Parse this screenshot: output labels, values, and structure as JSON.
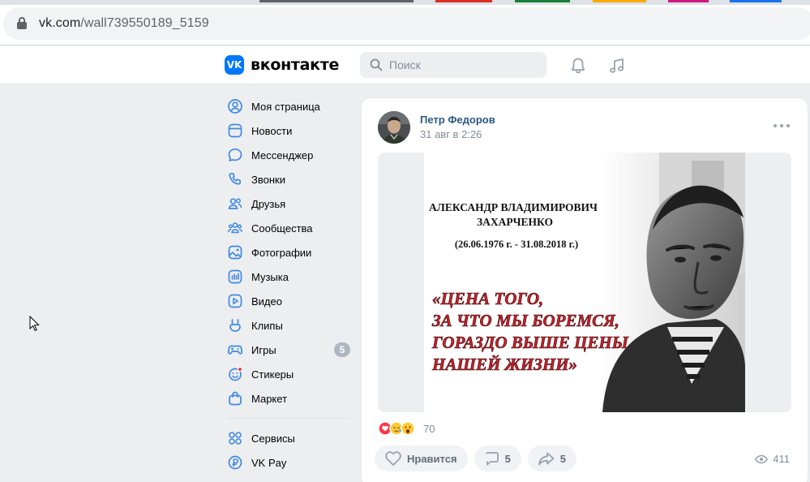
{
  "browser": {
    "url_host": "vk.com",
    "url_path": "/wall739550189_5159",
    "tab_colors": [
      "#2f6fd6",
      "#d93025",
      "#188038",
      "#f9ab00",
      "#d01884",
      "#1a73e8"
    ]
  },
  "header": {
    "logo_mark": "VK",
    "logo_text": "вконтакте",
    "search_placeholder": "Поиск",
    "notifications_icon": "bell-icon",
    "music_icon": "music-note-icon"
  },
  "nav": {
    "items": [
      {
        "label": "Моя страница",
        "icon": "user-circle-icon"
      },
      {
        "label": "Новости",
        "icon": "newsfeed-icon"
      },
      {
        "label": "Мессенджер",
        "icon": "message-bubble-icon"
      },
      {
        "label": "Звонки",
        "icon": "phone-icon"
      },
      {
        "label": "Друзья",
        "icon": "friends-icon"
      },
      {
        "label": "Сообщества",
        "icon": "communities-icon"
      },
      {
        "label": "Фотографии",
        "icon": "photo-icon"
      },
      {
        "label": "Музыка",
        "icon": "music-icon"
      },
      {
        "label": "Видео",
        "icon": "video-icon"
      },
      {
        "label": "Клипы",
        "icon": "clips-icon"
      },
      {
        "label": "Игры",
        "icon": "gamepad-icon",
        "badge": "5"
      },
      {
        "label": "Стикеры",
        "icon": "sticker-icon"
      },
      {
        "label": "Маркет",
        "icon": "market-bag-icon"
      }
    ],
    "secondary": [
      {
        "label": "Сервисы",
        "icon": "services-grid-icon"
      },
      {
        "label": "VK Pay",
        "icon": "vkpay-icon"
      }
    ]
  },
  "post": {
    "author": "Петр Федоров",
    "time": "31 авг в 2:26",
    "poster": {
      "name_line1": "АЛЕКСАНДР ВЛАДИМИРОВИЧ",
      "name_line2": "ЗАХАРЧЕНКО",
      "dates": "(26.06.1976 г. - 31.08.2018 г.)",
      "quote_lines": [
        "«ЦЕНА ТОГО,",
        "ЗА ЧТО МЫ БОРЕМСЯ,",
        "ГОРАЗДО ВЫШЕ ЦЕНЫ",
        "НАШЕЙ ЖИЗНИ»"
      ]
    },
    "reactions_count": "70",
    "like_label": "Нравится",
    "comments_count": "5",
    "shares_count": "5",
    "views_count": "411"
  },
  "colors": {
    "vk_blue": "#0077ff",
    "link_blue": "#2a5885",
    "quote_red": "#c8202a",
    "icon_blue": "#3f8ae0"
  }
}
